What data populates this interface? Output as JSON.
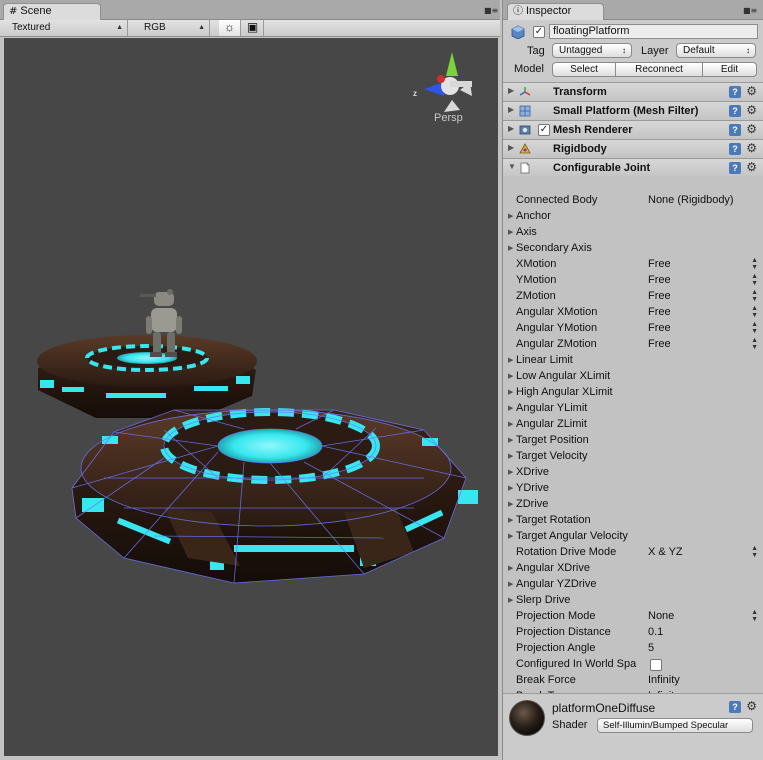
{
  "scene": {
    "tab_label": "Scene",
    "tab_icon": "grid-icon",
    "render_mode": "Textured",
    "color_mode": "RGB",
    "gizmo_label": "Persp",
    "gizmo_axis_z": "z"
  },
  "inspector": {
    "tab_label": "Inspector",
    "object_name": "floatingPlatform",
    "object_active": true,
    "tag_label": "Tag",
    "tag_value": "Untagged",
    "layer_label": "Layer",
    "layer_value": "Default",
    "model_label": "Model",
    "model_buttons": [
      "Select",
      "Reconnect",
      "Edit"
    ],
    "components": [
      {
        "title": "Transform",
        "icon": "transform-icon",
        "expanded": false
      },
      {
        "title": "Small Platform (Mesh Filter)",
        "icon": "mesh-filter-icon",
        "expanded": false
      },
      {
        "title": "Mesh Renderer",
        "icon": "mesh-renderer-icon",
        "expanded": false,
        "checkbox": true
      },
      {
        "title": "Rigidbody",
        "icon": "rigidbody-icon",
        "expanded": false
      },
      {
        "title": "Configurable Joint",
        "icon": "script-icon",
        "expanded": true
      }
    ],
    "joint_properties": [
      {
        "label": "Connected Body",
        "value": "None (Rigidbody)",
        "foldout": false
      },
      {
        "label": "Anchor",
        "value": "",
        "foldout": true
      },
      {
        "label": "Axis",
        "value": "",
        "foldout": true
      },
      {
        "label": "Secondary Axis",
        "value": "",
        "foldout": true
      },
      {
        "label": "XMotion",
        "value": "Free",
        "foldout": false,
        "spinner": true
      },
      {
        "label": "YMotion",
        "value": "Free",
        "foldout": false,
        "spinner": true
      },
      {
        "label": "ZMotion",
        "value": "Free",
        "foldout": false,
        "spinner": true
      },
      {
        "label": "Angular XMotion",
        "value": "Free",
        "foldout": false,
        "spinner": true
      },
      {
        "label": "Angular YMotion",
        "value": "Free",
        "foldout": false,
        "spinner": true
      },
      {
        "label": "Angular ZMotion",
        "value": "Free",
        "foldout": false,
        "spinner": true
      },
      {
        "label": "Linear Limit",
        "value": "",
        "foldout": true
      },
      {
        "label": "Low Angular XLimit",
        "value": "",
        "foldout": true
      },
      {
        "label": "High Angular XLimit",
        "value": "",
        "foldout": true
      },
      {
        "label": "Angular YLimit",
        "value": "",
        "foldout": true
      },
      {
        "label": "Angular ZLimit",
        "value": "",
        "foldout": true
      },
      {
        "label": "Target Position",
        "value": "",
        "foldout": true
      },
      {
        "label": "Target Velocity",
        "value": "",
        "foldout": true
      },
      {
        "label": "XDrive",
        "value": "",
        "foldout": true
      },
      {
        "label": "YDrive",
        "value": "",
        "foldout": true
      },
      {
        "label": "ZDrive",
        "value": "",
        "foldout": true
      },
      {
        "label": "Target Rotation",
        "value": "",
        "foldout": true
      },
      {
        "label": "Target Angular Velocity",
        "value": "",
        "foldout": true
      },
      {
        "label": "Rotation Drive Mode",
        "value": "X & YZ",
        "foldout": false,
        "spinner": true
      },
      {
        "label": "Angular XDrive",
        "value": "",
        "foldout": true
      },
      {
        "label": "Angular YZDrive",
        "value": "",
        "foldout": true
      },
      {
        "label": "Slerp Drive",
        "value": "",
        "foldout": true
      },
      {
        "label": "Projection Mode",
        "value": "None",
        "foldout": false,
        "spinner": true
      },
      {
        "label": "Projection Distance",
        "value": "0.1",
        "foldout": false
      },
      {
        "label": "Projection Angle",
        "value": "5",
        "foldout": false
      },
      {
        "label": "Configured In World Spa",
        "value": "",
        "foldout": false,
        "checkbox": true
      },
      {
        "label": "Break Force",
        "value": "Infinity",
        "foldout": false
      },
      {
        "label": "Break Torque",
        "value": "Infinity",
        "foldout": false
      }
    ],
    "material": {
      "name": "platformOneDiffuse",
      "shader_label": "Shader",
      "shader_value": "Self-Illumin/Bumped Specular"
    }
  },
  "colors": {
    "viewport_bg": "#474747",
    "glow": "#37e6ef",
    "wireframe": "#6b78ff",
    "platform_dark": "#2a1a12"
  }
}
